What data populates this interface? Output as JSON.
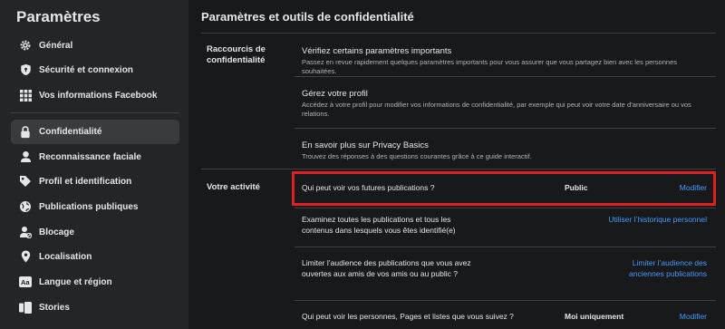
{
  "sidebar": {
    "title": "Paramètres",
    "items": [
      {
        "label": "Général",
        "icon": "gear-icon"
      },
      {
        "label": "Sécurité et connexion",
        "icon": "shield-icon"
      },
      {
        "label": "Vos informations Facebook",
        "icon": "grid-icon"
      },
      {
        "label": "Confidentialité",
        "icon": "lock-icon",
        "active": true
      },
      {
        "label": "Reconnaissance faciale",
        "icon": "face-icon"
      },
      {
        "label": "Profil et identification",
        "icon": "tag-icon"
      },
      {
        "label": "Publications publiques",
        "icon": "globe-icon"
      },
      {
        "label": "Blocage",
        "icon": "block-user-icon"
      },
      {
        "label": "Localisation",
        "icon": "location-pin-icon"
      },
      {
        "label": "Langue et région",
        "icon": "language-icon"
      },
      {
        "label": "Stories",
        "icon": "stories-icon"
      }
    ]
  },
  "main": {
    "title": "Paramètres et outils de confidentialité",
    "shortcuts": {
      "label": "Raccourcis de confidentialité",
      "items": [
        {
          "title": "Vérifiez certains paramètres importants",
          "desc": "Passez en revue rapidement quelques paramètres importants pour vous assurer que vous partagez bien avec les personnes souhaitées."
        },
        {
          "title": "Gérez votre profil",
          "desc": "Accédez à votre profil pour modifier vos informations de confidentialité, par exemple qui peut voir votre date d’anniversaire ou vos relations."
        },
        {
          "title": "En savoir plus sur Privacy Basics",
          "desc": "Trouvez des réponses à des questions courantes grâce à ce guide interactif."
        }
      ]
    },
    "activity": {
      "label": "Votre activité",
      "rows": [
        {
          "question": "Qui peut voir vos futures publications ?",
          "value": "Public",
          "action": "Modifier"
        },
        {
          "question": "Examinez toutes les publications et tous les contenus dans lesquels vous êtes identifié(e)",
          "value": "",
          "action": "Utiliser l’historique personnel"
        },
        {
          "question": "Limiter l’audience des publications que vous avez ouvertes aux amis de vos amis ou au public ?",
          "value": "",
          "action": "Limiter l’audience des anciennes publications"
        },
        {
          "question": "Qui peut voir les personnes, Pages et listes que vous suivez ?",
          "value": "Moi uniquement",
          "action": "Modifier"
        }
      ]
    }
  },
  "colors": {
    "sidebar_bg": "#242526",
    "main_bg": "#18191a",
    "link": "#4599ff",
    "highlight": "#e02020"
  }
}
